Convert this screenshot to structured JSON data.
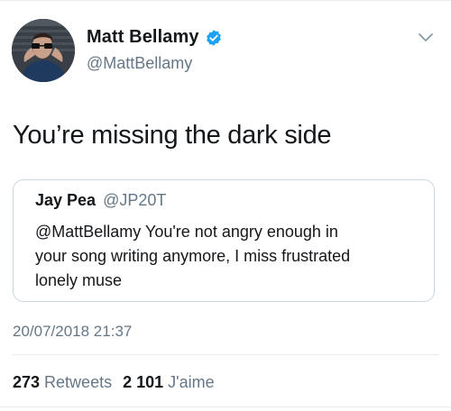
{
  "author": {
    "display_name": "Matt Bellamy",
    "handle": "@MattBellamy",
    "avatar": "profile-photo",
    "verified_icon": "verified-badge-icon",
    "verified_color": "#1da1f2"
  },
  "menu": {
    "icon": "chevron-down-icon"
  },
  "tweet": {
    "text": "You’re missing the dark side"
  },
  "quoted": {
    "display_name": "Jay Pea",
    "handle": "@JP20T",
    "text_lines": [
      "@MattBellamy You're not angry enough in",
      "your song writing anymore, I miss frustrated",
      "lonely muse"
    ]
  },
  "timestamp": "20/07/2018 21:37",
  "stats": {
    "retweets": {
      "count": "273",
      "label": "Retweets"
    },
    "likes": {
      "count": "2 101",
      "label": "J'aime"
    }
  },
  "colors": {
    "text": "#14171a",
    "secondary": "#657786",
    "border": "#ccd6dd",
    "divider": "#e6ecf0"
  }
}
